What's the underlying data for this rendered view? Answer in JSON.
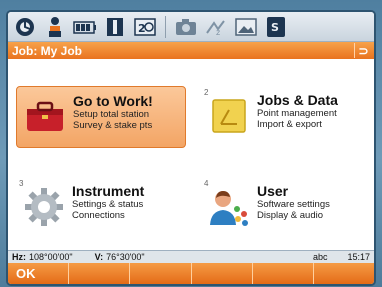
{
  "toolbar": {
    "icons": [
      "status-icon",
      "surveyor-icon",
      "battery-icon",
      "target-icon",
      "level-icon",
      "camera-icon",
      "radio-icon",
      "image-icon",
      "memory-icon"
    ]
  },
  "title": {
    "text": "Job: My Job",
    "back_glyph": "⊃"
  },
  "tiles": [
    {
      "num": "",
      "title": "Go to Work!",
      "line1": "Setup total station",
      "line2": "Survey & stake pts",
      "icon": "toolbox-icon"
    },
    {
      "num": "2",
      "title": "Jobs & Data",
      "line1": "Point management",
      "line2": "Import & export",
      "icon": "folder-icon"
    },
    {
      "num": "3",
      "title": "Instrument",
      "line1": "Settings & status",
      "line2": "Connections",
      "icon": "gear-icon"
    },
    {
      "num": "4",
      "title": "User",
      "line1": "Software settings",
      "line2": "Display & audio",
      "icon": "user-icon"
    }
  ],
  "status": {
    "hz_label": "Hz:",
    "hz_value": "108°00'00\"",
    "v_label": "V:",
    "v_value": "76°30'00\"",
    "mode": "abc",
    "time": "15:17"
  },
  "softkeys": [
    "OK",
    "",
    "",
    "",
    "",
    ""
  ],
  "colors": {
    "accent": "#e9731f",
    "selected_tile": "#f3a565"
  }
}
